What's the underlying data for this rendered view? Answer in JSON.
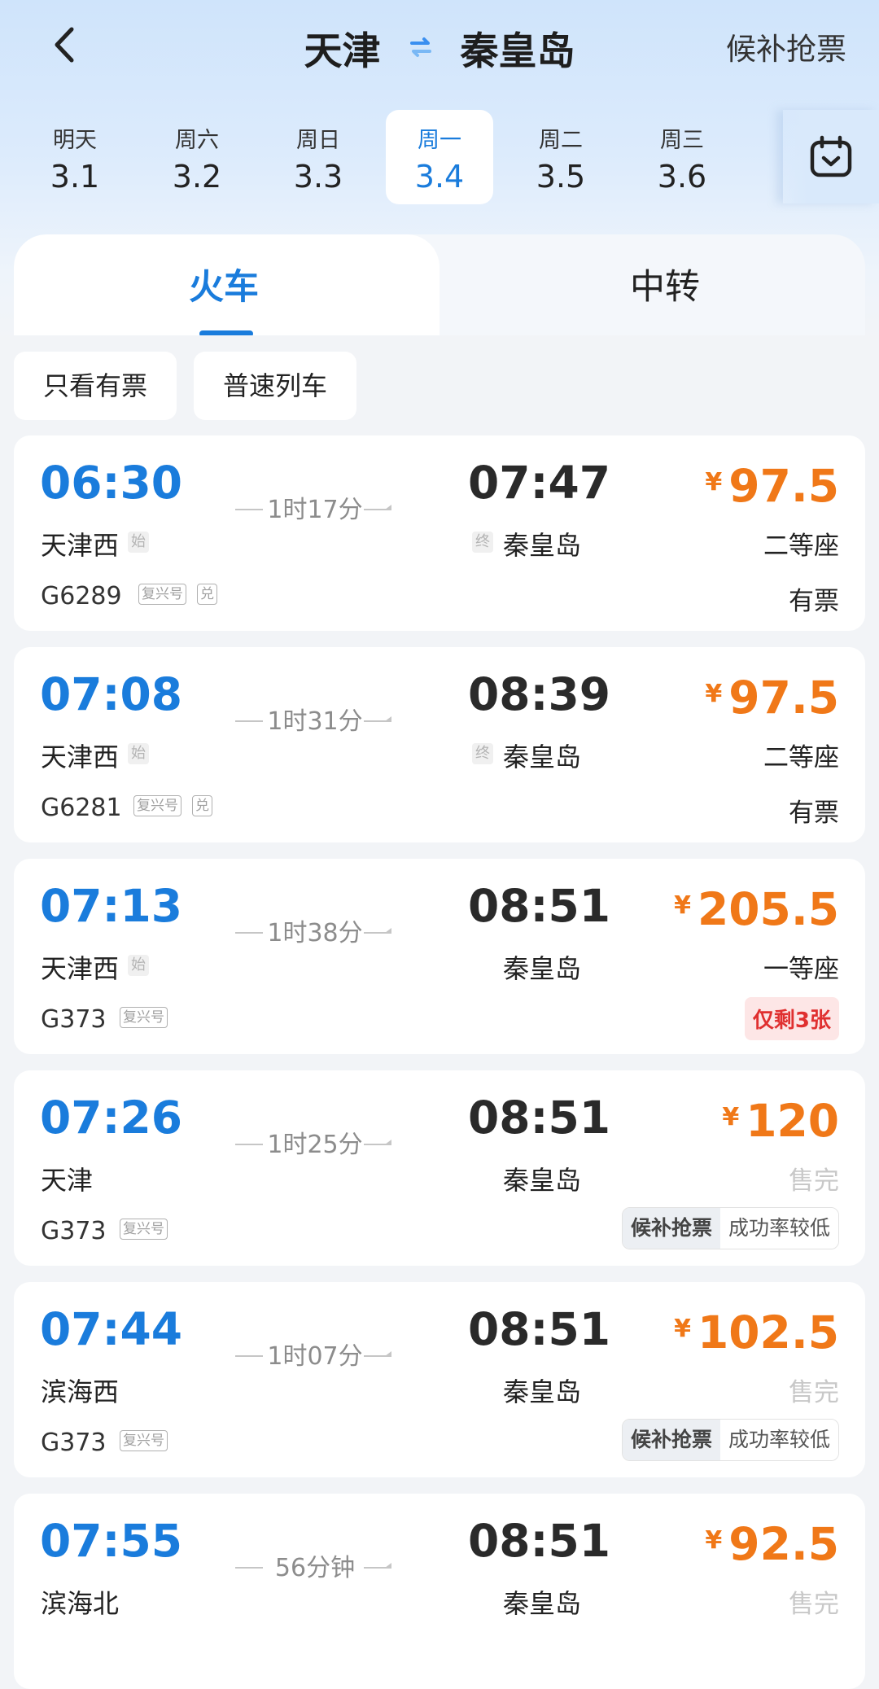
{
  "header": {
    "from_city": "天津",
    "to_city": "秦皇岛",
    "waitlist_label": "候补抢票"
  },
  "dates": [
    {
      "weekday": "明天",
      "date": "3.1"
    },
    {
      "weekday": "周六",
      "date": "3.2"
    },
    {
      "weekday": "周日",
      "date": "3.3"
    },
    {
      "weekday": "周一",
      "date": "3.4",
      "selected": true
    },
    {
      "weekday": "周二",
      "date": "3.5"
    },
    {
      "weekday": "周三",
      "date": "3.6"
    }
  ],
  "tabs": {
    "train": "火车",
    "transfer": "中转"
  },
  "filters": {
    "only_available": "只看有票",
    "regular_trains": "普速列车"
  },
  "labels": {
    "start_tag": "始",
    "end_tag": "终",
    "yen": "¥"
  },
  "trains": [
    {
      "depart": "06:30",
      "arrive": "07:47",
      "duration": "1时17分",
      "from": "天津西",
      "to": "秦皇岛",
      "number": "G6289",
      "tags": [
        "复兴号",
        "兑"
      ],
      "price": "97.5",
      "seat": "二等座",
      "status": "有票"
    },
    {
      "depart": "07:08",
      "arrive": "08:39",
      "duration": "1时31分",
      "from": "天津西",
      "to": "秦皇岛",
      "number": "G6281",
      "tags": [
        "复兴号",
        "兑"
      ],
      "price": "97.5",
      "seat": "二等座",
      "status": "有票"
    },
    {
      "depart": "07:13",
      "arrive": "08:51",
      "duration": "1时38分",
      "from": "天津西",
      "to": "秦皇岛",
      "number": "G373",
      "tags": [
        "复兴号"
      ],
      "price": "205.5",
      "seat": "一等座",
      "status": "仅剩3张"
    },
    {
      "depart": "07:26",
      "arrive": "08:51",
      "duration": "1时25分",
      "from": "天津",
      "to": "秦皇岛",
      "number": "G373",
      "tags": [
        "复兴号"
      ],
      "price": "120",
      "seat": "售完",
      "waitlist": "候补抢票",
      "waitlist_note": "成功率较低"
    },
    {
      "depart": "07:44",
      "arrive": "08:51",
      "duration": "1时07分",
      "from": "滨海西",
      "to": "秦皇岛",
      "number": "G373",
      "tags": [
        "复兴号"
      ],
      "price": "102.5",
      "seat": "售完",
      "waitlist": "候补抢票",
      "waitlist_note": "成功率较低"
    },
    {
      "depart": "07:55",
      "arrive": "08:51",
      "duration": "56分钟",
      "from": "滨海北",
      "to": "秦皇岛",
      "price": "92.5",
      "seat": "售完"
    }
  ]
}
